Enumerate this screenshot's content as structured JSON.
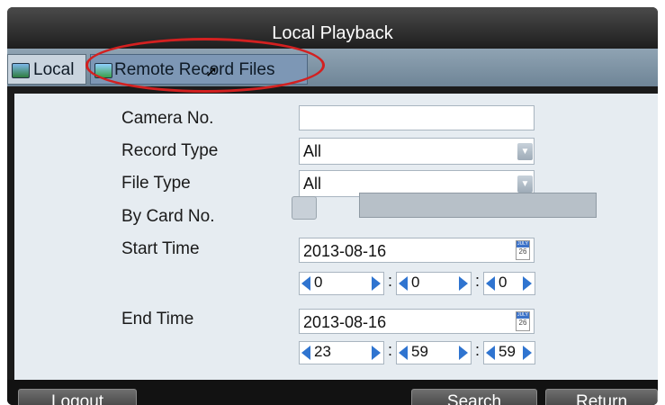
{
  "window": {
    "title": "Local Playback"
  },
  "tabs": [
    {
      "label": "Local"
    },
    {
      "label": "Remote Record Files"
    }
  ],
  "form": {
    "camera_no": {
      "label": "Camera No.",
      "value": ""
    },
    "record_type": {
      "label": "Record Type",
      "value": "All"
    },
    "file_type": {
      "label": "File Type",
      "value": "All"
    },
    "by_card_no": {
      "label": "By Card No.",
      "value": ""
    },
    "start_time": {
      "label": "Start Time",
      "date": "2013-08-16",
      "hour": "0",
      "minute": "0",
      "second": "0"
    },
    "end_time": {
      "label": "End Time",
      "date": "2013-08-16",
      "hour": "23",
      "minute": "59",
      "second": "59"
    },
    "calendar_icon": {
      "month": "JULY",
      "day": "26"
    },
    "separator": ":"
  },
  "buttons": {
    "logout": "Logout",
    "search": "Search",
    "return": "Return"
  }
}
